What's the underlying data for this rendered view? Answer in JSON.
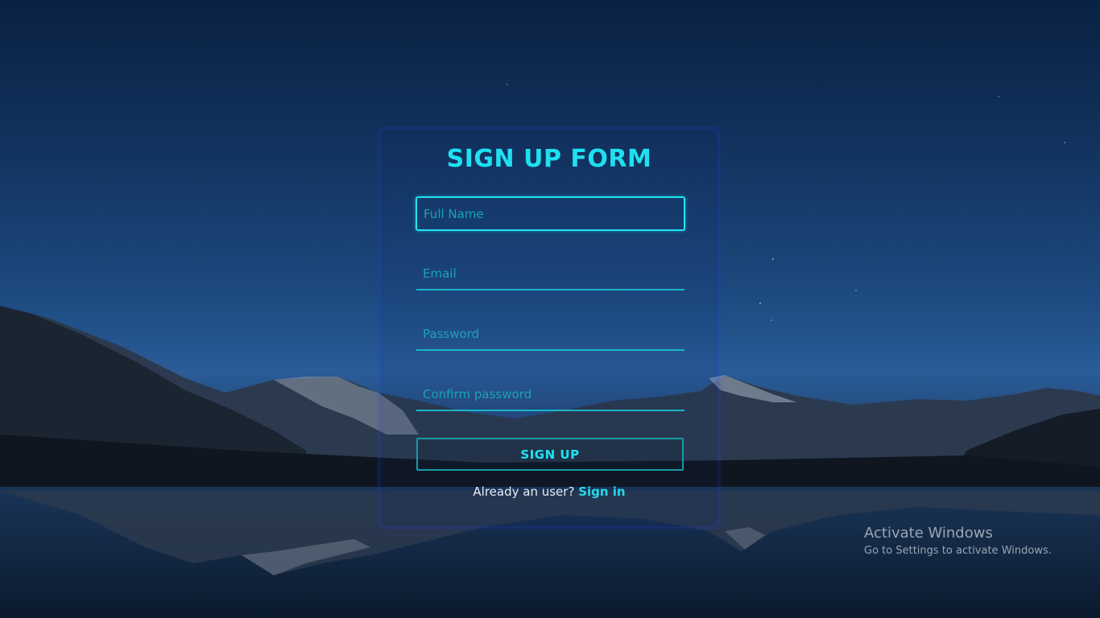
{
  "form": {
    "title": "SIGN UP FORM",
    "fields": {
      "full_name_placeholder": "Full Name",
      "email_placeholder": "Email",
      "password_placeholder": "Password",
      "confirm_password_placeholder": "Confirm password"
    },
    "submit_label": "SIGN UP",
    "signin_prompt": "Already an user?",
    "signin_link": "Sign in"
  },
  "os_watermark": {
    "title": "Activate Windows",
    "subtitle": "Go to Settings to activate Windows."
  },
  "colors": {
    "accent": "#1fe0f0",
    "field_border": "#19b6c8",
    "panel_glow": "#2838e6",
    "sky_top": "#0a2142",
    "sky_mid": "#2a5c98"
  }
}
